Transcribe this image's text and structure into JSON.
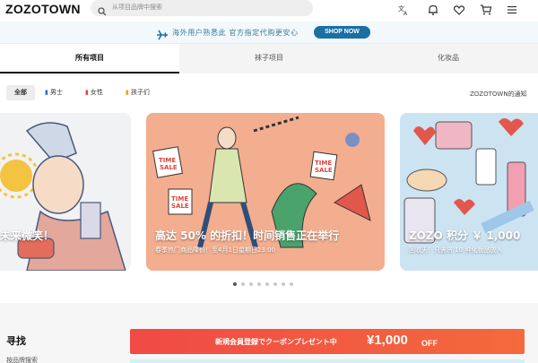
{
  "header": {
    "logo": "ZOZOTOWN",
    "search_placeholder": "从项目品牌中搜索"
  },
  "promo": {
    "text": "海外用户熟悉此 官方指定代购更安心",
    "shop_now": "SHOP NOW"
  },
  "tabs": [
    {
      "label": "所有项目",
      "active": true
    },
    {
      "label": "袜子项目",
      "active": false
    },
    {
      "label": "化妆品",
      "active": false
    }
  ],
  "filters": {
    "all": "全部",
    "men": "男士",
    "women": "女性",
    "kids": "孩子们",
    "notice": "ZOZOTOWN的通知"
  },
  "carousel": {
    "cards": [
      {
        "title": "未来微笑！",
        "subtitle": ""
      },
      {
        "title": "高达 50% 的折扣！时间销售正在举行",
        "subtitle": "春季热门商品降价！至4月1日星期日23:00"
      },
      {
        "title": "ZOZO 积分 ￥ 1,000",
        "subtitle": "回收天！只需将 10 种化妆品放入"
      }
    ],
    "page_count": 8,
    "current_page": 1
  },
  "bottom": {
    "search_title": "寻找",
    "search_sub": "按品牌搜索",
    "coupon_text": "新規会員登録でクーポンプレゼント中",
    "coupon_amount": "¥1,000",
    "coupon_off": "OFF"
  },
  "colors": {
    "accent_blue": "#1a6fa3",
    "coupon_red": "#f04a45",
    "men_icon": "#2b6fd6",
    "women_icon": "#e0453b",
    "kids_icon": "#e8a21c"
  }
}
